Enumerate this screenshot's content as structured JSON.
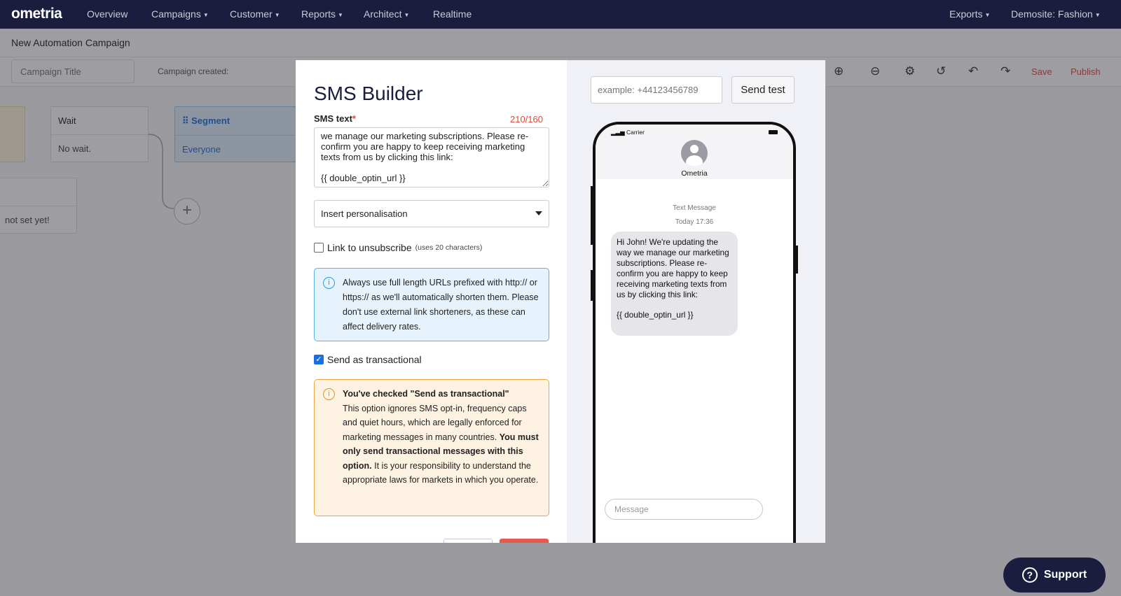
{
  "nav": {
    "logo": "ometria",
    "items": [
      {
        "label": "Overview",
        "caret": false
      },
      {
        "label": "Campaigns",
        "caret": true
      },
      {
        "label": "Customer",
        "caret": true
      },
      {
        "label": "Reports",
        "caret": true
      },
      {
        "label": "Architect",
        "caret": true
      },
      {
        "label": "Realtime",
        "caret": false
      }
    ],
    "exports": "Exports",
    "account": "Demosite: Fashion"
  },
  "page": {
    "title": "New Automation Campaign",
    "campaign_title_placeholder": "Campaign Title",
    "campaign_created": "Campaign created:",
    "save": "Save",
    "publish": "Publish"
  },
  "canvas": {
    "wait_node": {
      "title": "Wait",
      "body": "No wait."
    },
    "segment_node": {
      "title": "Segment",
      "body": "Everyone"
    },
    "partial_node": {
      "body": "not set yet!"
    }
  },
  "modal": {
    "title": "SMS Builder",
    "sms_label": "SMS text",
    "sms_required": "*",
    "sms_count": "210/160",
    "sms_text": "we manage our marketing subscriptions. Please re-confirm you are happy to keep receiving marketing texts from us by clicking this link:\n\n{{ double_optin_url }}",
    "personalisation": "Insert personalisation",
    "unsubscribe_label": "Link to unsubscribe",
    "unsubscribe_note": "(uses 20 characters)",
    "unsubscribe_checked": false,
    "info_text": "Always use full length URLs prefixed with http:// or https:// as we'll automatically shorten them. Please don't use external link shorteners, as these can affect delivery rates.",
    "transactional_label": "Send as transactional",
    "transactional_checked": true,
    "warn_title": "You've checked \"Send as transactional\"",
    "warn_text_1": "This option ignores SMS opt-in, frequency caps and quiet hours, which are legally enforced for marketing messages in many countries.",
    "warn_bold": "You must only send transactional messages with this option.",
    "warn_text_2": "It is your responsibility to understand the appropriate laws for markets in which you operate."
  },
  "preview": {
    "phone_placeholder": "example: +44123456789",
    "send_test": "Send test",
    "carrier": "Carrier",
    "contact": "Ometria",
    "meta_type": "Text Message",
    "meta_time": "Today 17:36",
    "message": "Hi John! We're updating the way we manage our marketing subscriptions. Please re-confirm you are happy to keep receiving marketing texts from us by clicking this link:\n\n{{ double_optin_url }}",
    "message_placeholder": "Message"
  },
  "support": {
    "label": "Support"
  },
  "colors": {
    "nav_bg": "#1a1d3d",
    "accent_red": "#e0473a",
    "info_blue": "#e6f3fc",
    "warn_orange": "#fef3e3"
  }
}
